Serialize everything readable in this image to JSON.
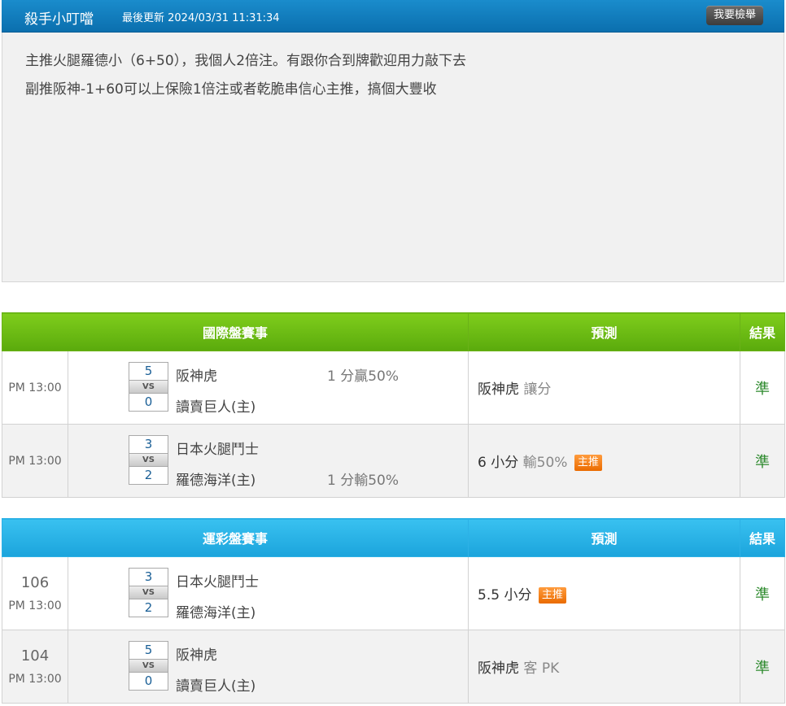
{
  "post": {
    "author": "殺手小叮噹",
    "updated": "最後更新 2024/03/31 11:31:34",
    "report_label": "我要檢舉",
    "lines": [
      "主推火腿羅德小（6+50），我個人2倍注。有跟你合到牌歡迎用力敲下去",
      "副推阪神-1+60可以上保險1倍注或者乾脆串信心主推，搞個大豐收"
    ]
  },
  "international": {
    "header_event": "國際盤賽事",
    "header_prediction": "預測",
    "header_result": "結果",
    "rows": [
      {
        "time": "PM 13:00",
        "score1": "5",
        "vs": "VS",
        "score2": "0",
        "team1": "阪神虎",
        "team2": "讀賣巨人(主)",
        "line1": "1 分贏50%",
        "line2": "",
        "pred_main": "阪神虎",
        "pred_note": "讓分",
        "badge": "",
        "result": "準"
      },
      {
        "time": "PM 13:00",
        "score1": "3",
        "vs": "VS",
        "score2": "2",
        "team1": "日本火腿鬥士",
        "team2": "羅德海洋(主)",
        "line1": "",
        "line2": "1 分輸50%",
        "pred_main": "6 小分",
        "pred_note": "輸50%",
        "badge": "主推",
        "result": "準"
      }
    ]
  },
  "lottery": {
    "header_event": "運彩盤賽事",
    "header_prediction": "預測",
    "header_result": "結果",
    "rows": [
      {
        "game_no": "106",
        "time": "PM 13:00",
        "score1": "3",
        "vs": "VS",
        "score2": "2",
        "team1": "日本火腿鬥士",
        "team2": "羅德海洋(主)",
        "pred_main": "5.5 小分",
        "pred_note": "",
        "badge": "主推",
        "result": "準"
      },
      {
        "game_no": "104",
        "time": "PM 13:00",
        "score1": "5",
        "vs": "VS",
        "score2": "0",
        "team1": "阪神虎",
        "team2": "讀賣巨人(主)",
        "pred_main": "阪神虎",
        "pred_note": "客 PK",
        "badge": "",
        "result": "準"
      }
    ]
  },
  "colors": {
    "header_blue": "#0b6fae",
    "green_header": "#5aaa0c",
    "blue_header": "#1ba4dc",
    "badge_orange": "#ea6b00",
    "result_green": "#2f8b2f"
  }
}
